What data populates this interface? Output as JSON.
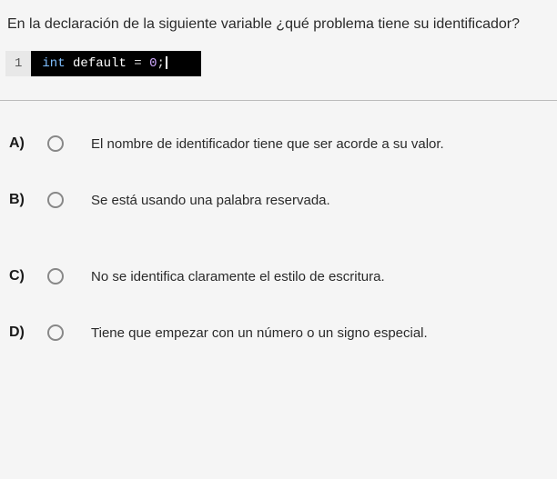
{
  "question": "En la declaración de la siguiente variable ¿qué problema tiene su identificador?",
  "code": {
    "line_number": "1",
    "token_int": "int",
    "token_default": "default",
    "token_eq": "=",
    "token_zero": "0",
    "token_semi": ";"
  },
  "options": [
    {
      "letter": "A)",
      "text": "El nombre de identificador tiene que ser acorde a su valor."
    },
    {
      "letter": "B)",
      "text": "Se está usando una palabra reservada."
    },
    {
      "letter": "C)",
      "text": "No se identifica claramente el estilo de escritura."
    },
    {
      "letter": "D)",
      "text": "Tiene que empezar con un número o un signo especial."
    }
  ]
}
